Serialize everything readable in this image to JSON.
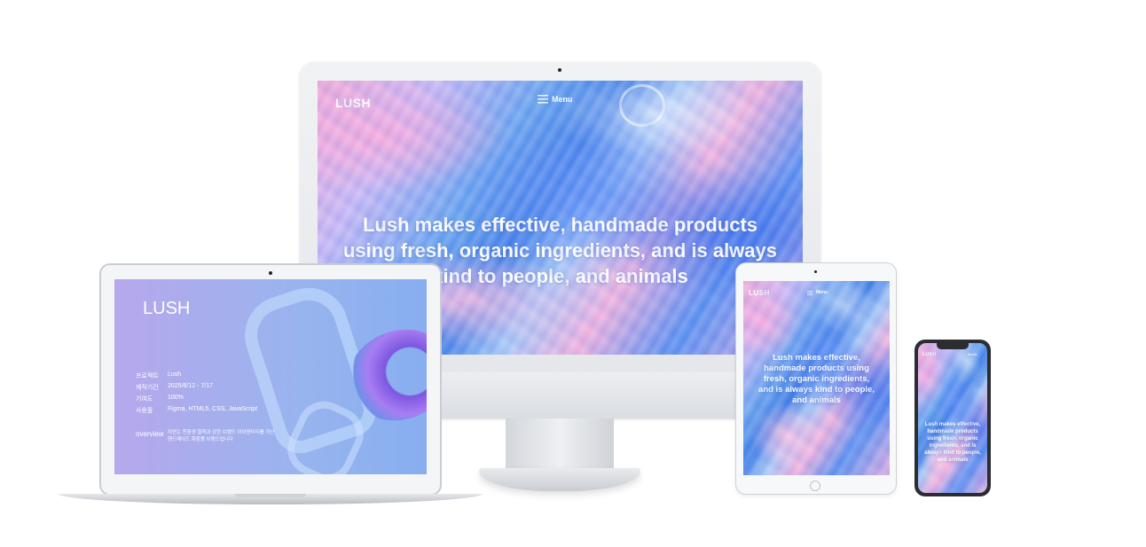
{
  "desktop": {
    "logo": "LUSH",
    "menu_label": "Menu",
    "menu_icon": "hamburger-icon",
    "hero_line1": "Lush makes effective, handmade products",
    "hero_line2": "using fresh, organic ingredients, and is always",
    "hero_line3": "kind to people, and animals"
  },
  "laptop": {
    "logo": "LUSH",
    "info": [
      {
        "key": "프로젝트",
        "value": "Lush"
      },
      {
        "key": "제작기간",
        "value": "2025/6/12 - 7/17"
      },
      {
        "key": "기여도",
        "value": "100%"
      },
      {
        "key": "사용툴",
        "value": "Figma, HTML5, CSS, JavaScript"
      }
    ],
    "overview_label": "overview",
    "overview_text1": "자연는 친환경 철학과 강한 브랜드 아이덴티티를 지닌",
    "overview_text2": "핸드메이드 화장품 브랜드입니다"
  },
  "tablet": {
    "logo": "LUSH",
    "menu_label": "Menu",
    "hero": "Lush makes effective, handmade products using fresh, organic ingredients, and is always kind to people, and animals"
  },
  "phone": {
    "logo": "LUSH",
    "menu_label": "Menu",
    "hero": "Lush makes effective, handmade products using fresh, organic ingredients, and is always kind to people, and animals"
  },
  "colors": {
    "accent_blue": "#3f7ee6",
    "accent_pink": "#f6a9d6",
    "laptop_bg": "#98b4ee"
  }
}
